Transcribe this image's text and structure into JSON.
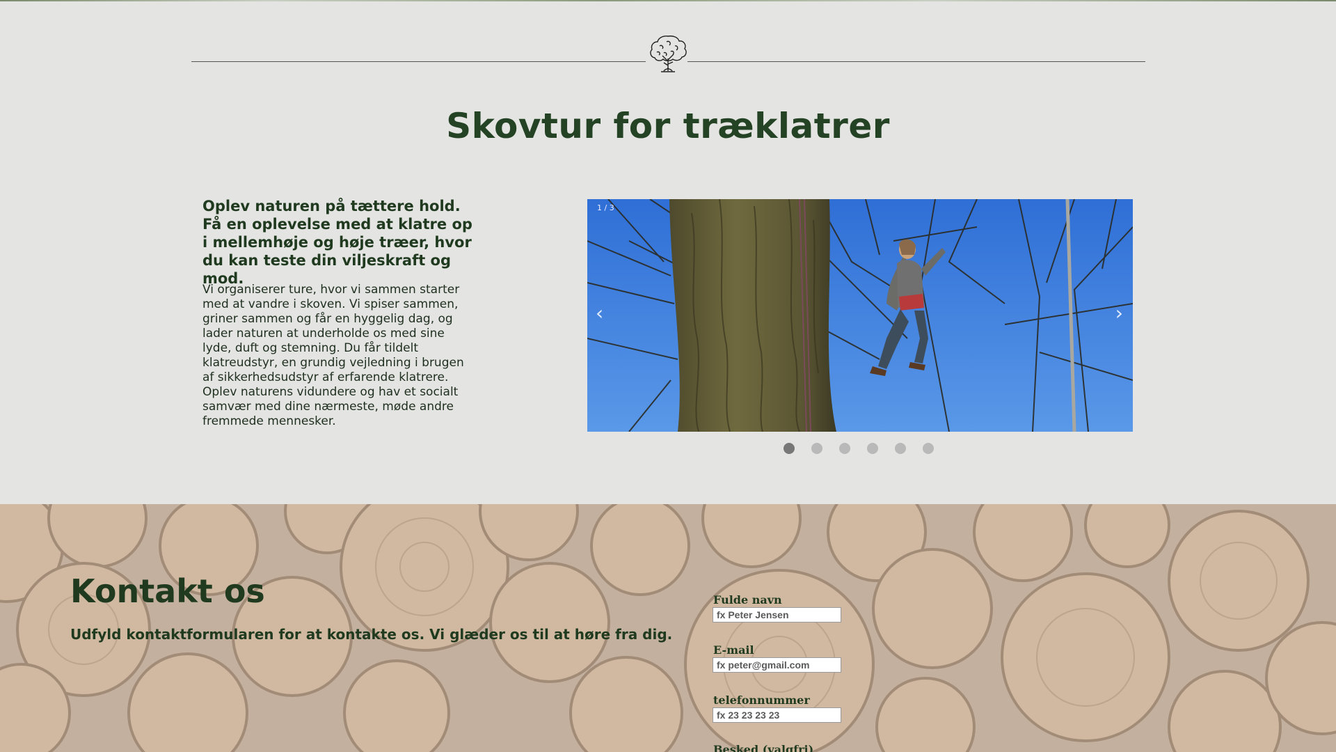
{
  "page": {
    "title": "Skovtur for træklatrer",
    "intro_lead": "Oplev naturen på tættere hold. Få en oplevelse med at klatre op i mellemhøje og høje træer, hvor du kan teste din viljeskraft og mod.",
    "intro_body": "Vi organiserer ture, hvor vi sammen starter med at vandre i skoven. Vi spiser sammen, griner sammen og får en hyggelig dag, og lader naturen at underholde os med sine lyde, duft og stemning. Du får tildelt klatreudstyr, en grundig vejledning i brugen af sikkerhedsudstyr af erfarende klatrere. Oplev naturens vidundere og hav et socialt samvær med dine nærmeste, møde andre fremmede mennesker."
  },
  "slideshow": {
    "counter": "1 / 3",
    "prev_icon": "chevron-left-icon",
    "next_icon": "chevron-right-icon",
    "prev_glyph": "‹",
    "next_glyph": "›",
    "dot_count": 6,
    "active_dot": 0
  },
  "contact": {
    "title": "Kontakt os",
    "subtitle": "Udfyld kontaktformularen for at kontakte os. Vi glæder os til at høre fra dig.",
    "fields": [
      {
        "label": "Fulde navn",
        "placeholder": "fx Peter Jensen"
      },
      {
        "label": "E-mail",
        "placeholder": "fx peter@gmail.com"
      },
      {
        "label": "telefonnummer",
        "placeholder": "fx 23 23 23 23"
      },
      {
        "label": "Besked (valgfri)"
      }
    ]
  },
  "colors": {
    "background": "#e4e4e2",
    "heading_green": "#244224",
    "text_green": "#1f3a1f",
    "dot_inactive": "#b9b9b9",
    "dot_active": "#777777"
  }
}
